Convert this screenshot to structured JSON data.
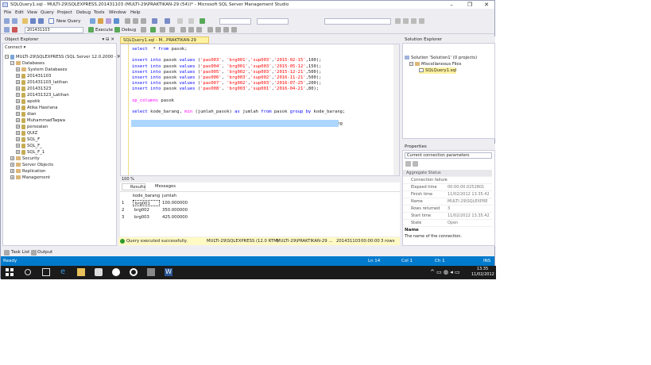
{
  "window": {
    "title": "SQLQuery1.sql - MULTI-29\\SQLEXPRESS.201431103 (MULTI-29\\PRAKTIKAN-29 (54))* - Microsoft SQL Server Management Studio",
    "minimize": "–",
    "restore": "❐",
    "close": "✕"
  },
  "menu": [
    "File",
    "Edit",
    "View",
    "Query",
    "Project",
    "Debug",
    "Tools",
    "Window",
    "Help"
  ],
  "toolbar": {
    "new_query": "New Query",
    "database": "201431103",
    "execute": "Execute",
    "debug": "Debug"
  },
  "object_explorer": {
    "title": "Object Explorer",
    "connect": "Connect ▾",
    "root": "MULTI-29\\SQLEXPRESS (SQL Server 12.0.2000 - MULTI",
    "databases": "Databases",
    "db_items": [
      "System Databases",
      "201431103",
      "201431103_latihan",
      "201431323",
      "201431323_Latihan",
      "apotik",
      "Atika Hasriana",
      "dian",
      "MuhammadTaqwa",
      "persoalan",
      "QUIZ",
      "SQL_F",
      "SQL_F_",
      "SQL_F_1"
    ],
    "other": [
      "Security",
      "Server Objects",
      "Replication",
      "Management"
    ]
  },
  "editor": {
    "tab": "SQLQuery1.sql - M...PRAKTIKAN-29 (54))*",
    "zoom": "100 %",
    "lines": [
      {
        "parts": [
          [
            "kw",
            "select"
          ],
          [
            "",
            "  * "
          ],
          [
            "kw",
            "from"
          ],
          [
            "",
            " pasok;"
          ]
        ]
      },
      {
        "parts": []
      },
      {
        "parts": [
          [
            "kw",
            "insert into"
          ],
          [
            "",
            " pasok "
          ],
          [
            "kw",
            "values"
          ],
          [
            "",
            " ("
          ],
          [
            "str",
            "'pas003'"
          ],
          [
            "",
            ", "
          ],
          [
            "str",
            "'brg001'"
          ],
          [
            "",
            ","
          ],
          [
            "str",
            "'sup003'"
          ],
          [
            "",
            ","
          ],
          [
            "str",
            "'2015-02-15'"
          ],
          [
            "",
            ",100);"
          ]
        ]
      },
      {
        "parts": [
          [
            "kw",
            "insert into"
          ],
          [
            "",
            " pasok "
          ],
          [
            "kw",
            "values"
          ],
          [
            "",
            " ("
          ],
          [
            "str",
            "'pas004'"
          ],
          [
            "",
            ", "
          ],
          [
            "str",
            "'brg001'"
          ],
          [
            "",
            ","
          ],
          [
            "str",
            "'sup003'"
          ],
          [
            "",
            ","
          ],
          [
            "str",
            "'2015-05-12'"
          ],
          [
            "",
            ",150);"
          ]
        ]
      },
      {
        "parts": [
          [
            "kw",
            "insert into"
          ],
          [
            "",
            " pasok "
          ],
          [
            "kw",
            "values"
          ],
          [
            "",
            " ("
          ],
          [
            "str",
            "'pas005'"
          ],
          [
            "",
            ", "
          ],
          [
            "str",
            "'brg002'"
          ],
          [
            "",
            ","
          ],
          [
            "str",
            "'sup003'"
          ],
          [
            "",
            ","
          ],
          [
            "str",
            "'2015-12-21'"
          ],
          [
            "",
            ",500);"
          ]
        ]
      },
      {
        "parts": [
          [
            "kw",
            "insert into"
          ],
          [
            "",
            " pasok "
          ],
          [
            "kw",
            "values"
          ],
          [
            "",
            " ("
          ],
          [
            "str",
            "'pas006'"
          ],
          [
            "",
            ", "
          ],
          [
            "str",
            "'brg003'"
          ],
          [
            "",
            ","
          ],
          [
            "str",
            "'sup002'"
          ],
          [
            "",
            ","
          ],
          [
            "str",
            "'2016-11-21'"
          ],
          [
            "",
            ",500);"
          ]
        ]
      },
      {
        "parts": [
          [
            "kw",
            "insert into"
          ],
          [
            "",
            " pasok "
          ],
          [
            "kw",
            "values"
          ],
          [
            "",
            " ("
          ],
          [
            "str",
            "'pas007'"
          ],
          [
            "",
            ", "
          ],
          [
            "str",
            "'brg002'"
          ],
          [
            "",
            ","
          ],
          [
            "str",
            "'sup003'"
          ],
          [
            "",
            ","
          ],
          [
            "str",
            "'2016-07-25'"
          ],
          [
            "",
            ",200);"
          ]
        ]
      },
      {
        "parts": [
          [
            "kw",
            "insert into"
          ],
          [
            "",
            " pasok "
          ],
          [
            "kw",
            "values"
          ],
          [
            "",
            " ("
          ],
          [
            "str",
            "'pas008'"
          ],
          [
            "",
            ", "
          ],
          [
            "str",
            "'brg003'"
          ],
          [
            "",
            ","
          ],
          [
            "str",
            "'sup001'"
          ],
          [
            "",
            ","
          ],
          [
            "str",
            "'2016-04-21'"
          ],
          [
            "",
            ",80);"
          ]
        ]
      },
      {
        "parts": []
      },
      {
        "parts": [
          [
            "fn",
            "sp_columns"
          ],
          [
            "",
            " pasok"
          ]
        ]
      },
      {
        "parts": []
      },
      {
        "parts": [
          [
            "kw",
            "select"
          ],
          [
            "",
            " kode_barang, "
          ],
          [
            "fn",
            "min"
          ],
          [
            "",
            " (jumlah_pasok) "
          ],
          [
            "kw",
            "as"
          ],
          [
            "",
            " jumlah "
          ],
          [
            "kw",
            "from"
          ],
          [
            "",
            " pasok "
          ],
          [
            "kw",
            "group by"
          ],
          [
            "",
            " kode_barang;"
          ]
        ]
      },
      {
        "parts": []
      },
      {
        "parts": [
          [
            "kw",
            "select"
          ],
          [
            "",
            " kode_barang, "
          ],
          [
            "fn",
            "avg"
          ],
          [
            "",
            " (jumlah_pasok) "
          ],
          [
            "kw",
            "as"
          ],
          [
            "",
            " jumlah "
          ],
          [
            "kw",
            "from"
          ],
          [
            "",
            " pasok "
          ],
          [
            "kw",
            "group by"
          ],
          [
            "",
            " kode_barang"
          ]
        ]
      }
    ]
  },
  "results": {
    "tabs": [
      "Results",
      "Messages"
    ],
    "columns": [
      "kode_barang",
      "jumlah"
    ],
    "rows": [
      [
        "1",
        "brg001",
        "100.000000"
      ],
      [
        "2",
        "brg002",
        "350.000000"
      ],
      [
        "3",
        "brg003",
        "425.000000"
      ]
    ]
  },
  "query_status": {
    "message": "Query executed successfully.",
    "server": "MULTI-29\\SQLEXPRESS (12.0 RTM)",
    "user": "MULTI-29\\PRAKTIKAN-29 ...",
    "db": "201431103",
    "time": "00:00:00",
    "rows": "3 rows"
  },
  "solution_explorer": {
    "title": "Solution Explorer",
    "solution": "Solution 'Solution1' (0 projects)",
    "folder": "Miscellaneous Files",
    "file": "SQLQuery1.sql"
  },
  "properties": {
    "title": "Properties",
    "selector": "Current connection parameters",
    "section": "Aggregate Status",
    "items": [
      [
        "Connection failure",
        ""
      ],
      [
        "Elapsed time",
        "00:00:00.0252801"
      ],
      [
        "Finish time",
        "11/02/2012 13.35.42"
      ],
      [
        "Name",
        "MULTI-29\\SQLEXPRE"
      ],
      [
        "Rows returned",
        "3"
      ],
      [
        "Start time",
        "11/02/2012 13.35.42"
      ],
      [
        "State",
        "Open"
      ]
    ],
    "desc_title": "Name",
    "desc_text": "The name of the connection."
  },
  "bottom_tabs": [
    "Task List",
    "Output"
  ],
  "statusbar": {
    "ready": "Ready",
    "ln": "Ln 14",
    "col": "Col 1",
    "ch": "Ch 1",
    "ins": "INS"
  },
  "taskbar": {
    "time": "13.35",
    "date": "11/02/2012"
  }
}
